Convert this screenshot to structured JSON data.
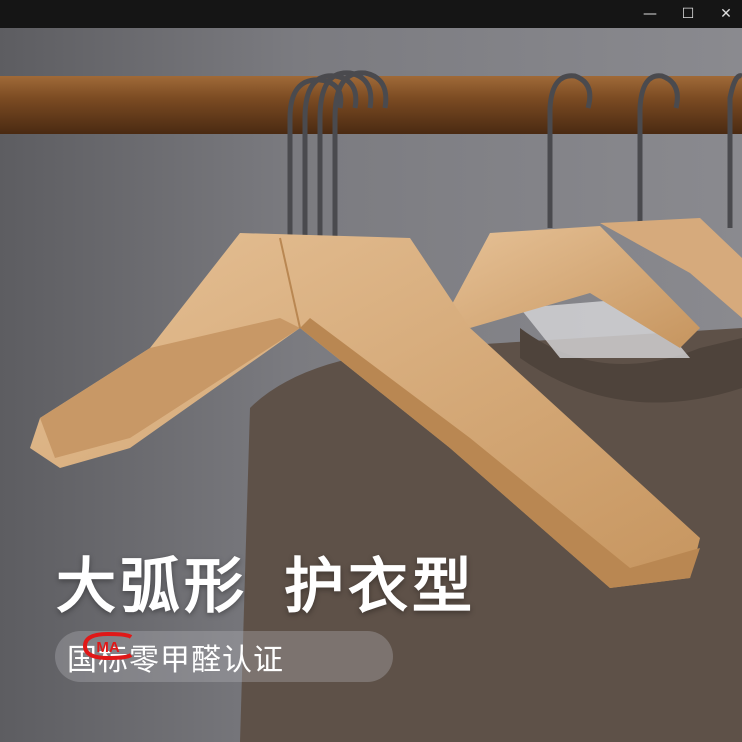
{
  "window": {
    "minimize_icon": "minimize-icon",
    "maximize_icon": "maximize-icon",
    "close_icon": "close-icon",
    "minimize": "—",
    "maximize": "☐",
    "close": "✕"
  },
  "banner": {
    "headline_part1": "大弧形",
    "headline_part2": "护衣型",
    "badge_logo": "CMA",
    "badge_text": "国标零甲醛认证"
  },
  "colors": {
    "rod": "#7a4a22",
    "wood": "#d8ad80",
    "sweater": "#5e5148",
    "badge_red": "#e01818"
  }
}
